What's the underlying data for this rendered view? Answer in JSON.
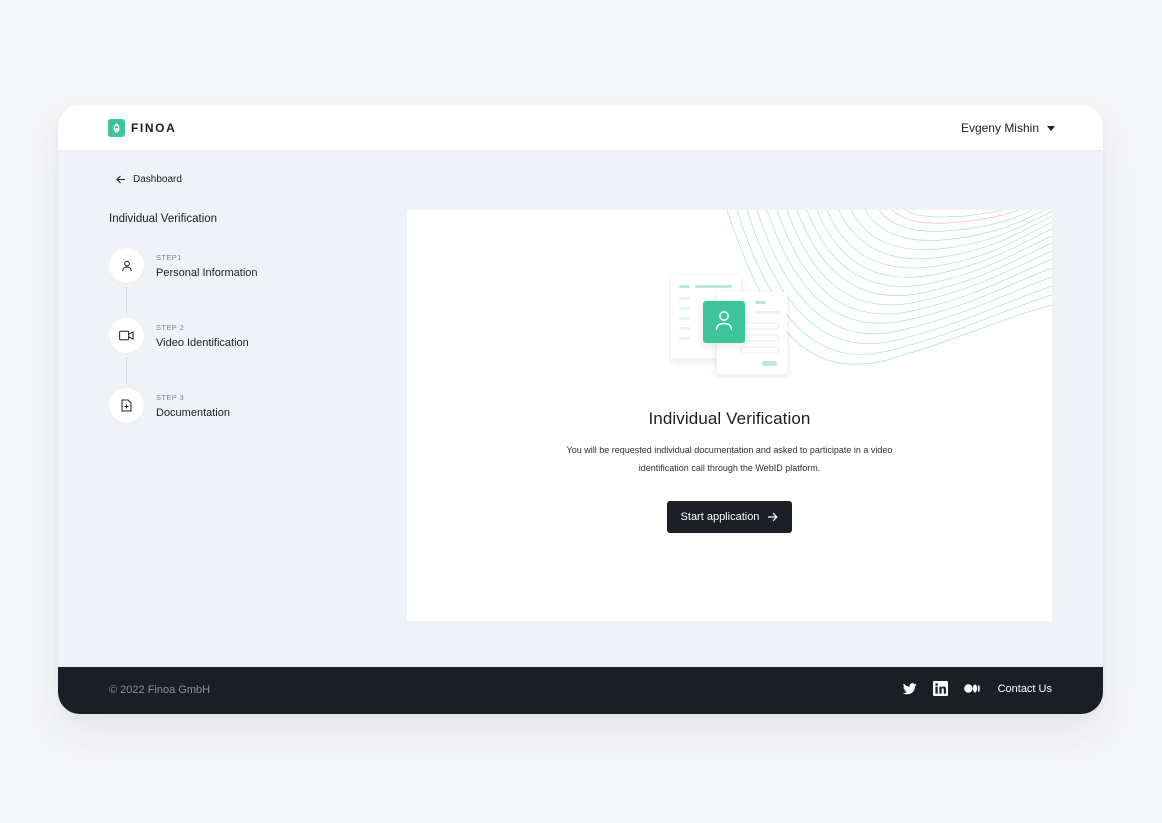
{
  "brand": {
    "name": "FINOA",
    "accent": "#3cc49a"
  },
  "header": {
    "user_name": "Evgeny Mishin"
  },
  "nav": {
    "back_label": "Dashboard"
  },
  "sidebar": {
    "title": "Individual Verification",
    "steps": [
      {
        "kicker": "STEP1",
        "label": "Personal Information",
        "icon": "person-icon"
      },
      {
        "kicker": "STEP 2",
        "label": "Video Identification",
        "icon": "video-camera-icon"
      },
      {
        "kicker": "STEP 3",
        "label": "Documentation",
        "icon": "document-add-icon"
      }
    ]
  },
  "main": {
    "title": "Individual Verification",
    "description": "You will be requested individual documentation and asked to participate in a video identification call through the WebID platform.",
    "start_button": "Start application"
  },
  "footer": {
    "copyright": "© 2022 Finoa GmbH",
    "socials": [
      "twitter-icon",
      "linkedin-icon",
      "medium-icon"
    ],
    "contact_label": "Contact Us"
  }
}
